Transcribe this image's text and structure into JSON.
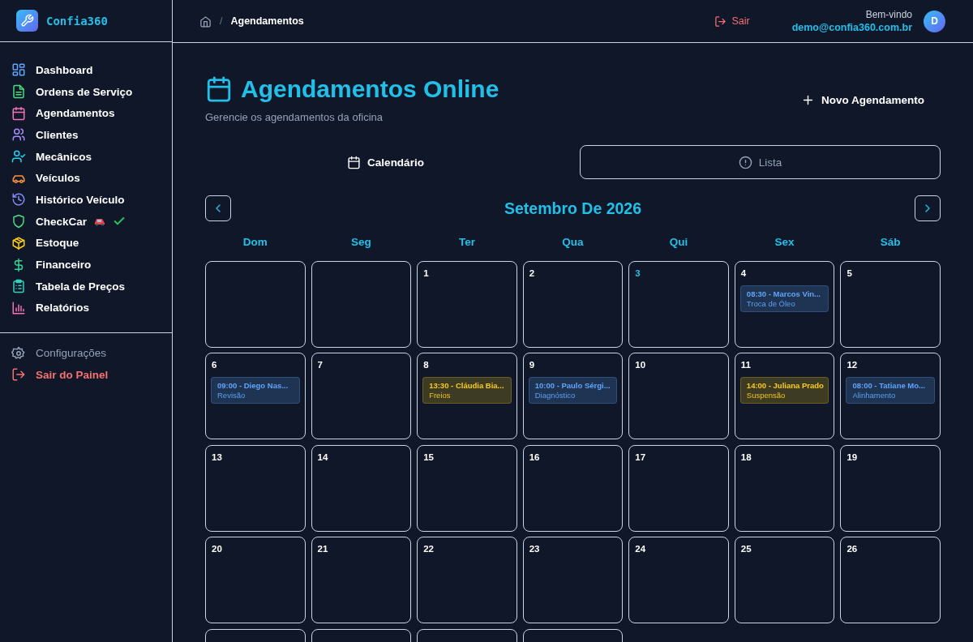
{
  "brand": {
    "name": "Confia360"
  },
  "sidebar": {
    "items": [
      {
        "label": "Dashboard",
        "color": "#60a5fa"
      },
      {
        "label": "Ordens de Serviço",
        "color": "#4ade80"
      },
      {
        "label": "Agendamentos",
        "color": "#f472b6"
      },
      {
        "label": "Clientes",
        "color": "#a78bfa"
      },
      {
        "label": "Mecânicos",
        "color": "#22d3ee"
      },
      {
        "label": "Veículos",
        "color": "#fb923c"
      },
      {
        "label": "Histórico Veículo",
        "color": "#818cf8"
      },
      {
        "label": "CheckCar",
        "color": "#4ade80"
      },
      {
        "label": "Estoque",
        "color": "#facc15"
      },
      {
        "label": "Financeiro",
        "color": "#34d399"
      },
      {
        "label": "Tabela de Preços",
        "color": "#2dd4bf"
      },
      {
        "label": "Relatórios",
        "color": "#f472b6"
      }
    ],
    "footer": [
      {
        "label": "Configurações",
        "kind": "muted"
      },
      {
        "label": "Sair do Painel",
        "kind": "danger"
      }
    ]
  },
  "breadcrumb": {
    "separator": "/",
    "current": "Agendamentos"
  },
  "user": {
    "logout": "Sair",
    "greeting": "Bem-vindo",
    "email": "demo@confia360.com.br",
    "initial": "D"
  },
  "page": {
    "title": "Agendamentos Online",
    "subtitle": "Gerencie os agendamentos da oficina",
    "new_button": "Novo Agendamento"
  },
  "tabs": [
    {
      "label": "Calendário",
      "selected": true
    },
    {
      "label": "Lista",
      "selected": false
    }
  ],
  "calendar": {
    "month": "Setembro De 2026",
    "weekdays": [
      "Dom",
      "Seg",
      "Ter",
      "Qua",
      "Qui",
      "Sex",
      "Sáb"
    ],
    "weeks": [
      [
        {
          "kind": "blank"
        },
        {
          "kind": "blank"
        },
        {
          "kind": "day",
          "day": "1",
          "today": false
        },
        {
          "kind": "day",
          "day": "2",
          "today": false
        },
        {
          "kind": "day",
          "day": "3",
          "today": true
        },
        {
          "kind": "day",
          "day": "4",
          "today": false,
          "events": [
            {
              "title": "08:30 - Marcos Vin...",
              "service": "Troca de Óleo",
              "color": "#60a5fa"
            }
          ]
        },
        {
          "kind": "day",
          "day": "5",
          "today": false
        }
      ],
      [
        {
          "kind": "day",
          "day": "6",
          "today": false,
          "events": [
            {
              "title": "09:00 - Diego Nas...",
              "service": "Revisão",
              "color": "#60a5fa"
            }
          ]
        },
        {
          "kind": "day",
          "day": "7",
          "today": false
        },
        {
          "kind": "day",
          "day": "8",
          "today": false,
          "events": [
            {
              "title": "13:30 - Cláudia Bia...",
              "service": "Freios",
              "color": "#facc15"
            }
          ]
        },
        {
          "kind": "day",
          "day": "9",
          "today": false,
          "events": [
            {
              "title": "10:00 - Paulo Sérgi...",
              "service": "Diagnóstico",
              "color": "#60a5fa"
            }
          ]
        },
        {
          "kind": "day",
          "day": "10",
          "today": false
        },
        {
          "kind": "day",
          "day": "11",
          "today": false,
          "events": [
            {
              "title": "14:00 - Juliana Prado",
              "service": "Suspensão",
              "color": "#facc15"
            }
          ]
        },
        {
          "kind": "day",
          "day": "12",
          "today": false,
          "events": [
            {
              "title": "08:00 - Tatiane Mo...",
              "service": "Alinhamento",
              "color": "#60a5fa"
            }
          ]
        }
      ],
      [
        {
          "kind": "day",
          "day": "13",
          "today": false
        },
        {
          "kind": "day",
          "day": "14",
          "today": false
        },
        {
          "kind": "day",
          "day": "15",
          "today": false
        },
        {
          "kind": "day",
          "day": "16",
          "today": false
        },
        {
          "kind": "day",
          "day": "17",
          "today": false
        },
        {
          "kind": "day",
          "day": "18",
          "today": false
        },
        {
          "kind": "day",
          "day": "19",
          "today": false
        }
      ],
      [
        {
          "kind": "day",
          "day": "20",
          "today": false
        },
        {
          "kind": "day",
          "day": "21",
          "today": false
        },
        {
          "kind": "day",
          "day": "22",
          "today": false
        },
        {
          "kind": "day",
          "day": "23",
          "today": false
        },
        {
          "kind": "day",
          "day": "24",
          "today": false
        },
        {
          "kind": "day",
          "day": "25",
          "today": false
        },
        {
          "kind": "day",
          "day": "26",
          "today": false
        }
      ],
      [
        {
          "kind": "blank"
        },
        {
          "kind": "blank"
        },
        {
          "kind": "blank"
        },
        {
          "kind": "blank"
        }
      ]
    ]
  }
}
